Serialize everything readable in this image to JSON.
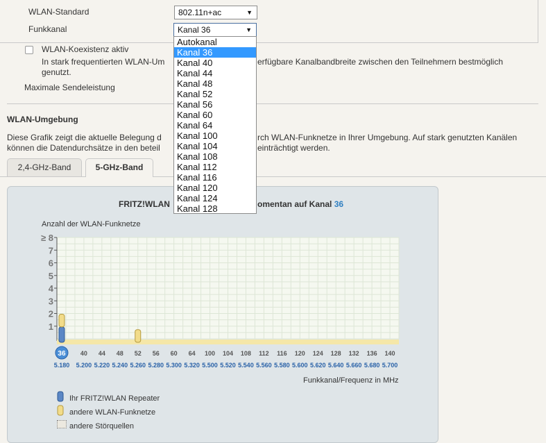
{
  "settings": {
    "wlan_standard_label": "WLAN-Standard",
    "wlan_standard_value": "802.11n+ac",
    "funkkanal_label": "Funkkanal",
    "funkkanal_value": "Kanal 36",
    "coexist_label": "WLAN-Koexistenz aktiv",
    "coexist_desc_part1": "In stark frequentierten WLAN-Um",
    "coexist_desc_part2": "erfügbare Kanalbandbreite zwischen den Teilnehmern bestmöglich",
    "coexist_desc_line2": "genutzt.",
    "sendeleistung_label": "Maximale Sendeleistung"
  },
  "dropdown": {
    "items": [
      "Autokanal",
      "Kanal 36",
      "Kanal 40",
      "Kanal 44",
      "Kanal 48",
      "Kanal 52",
      "Kanal 56",
      "Kanal 60",
      "Kanal 64",
      "Kanal 100",
      "Kanal 104",
      "Kanal 108",
      "Kanal 112",
      "Kanal 116",
      "Kanal 120",
      "Kanal 124",
      "Kanal 128"
    ],
    "selected_index": 1
  },
  "umgebung": {
    "heading": "WLAN-Umgebung",
    "desc_line1a": "Diese Grafik zeigt die aktuelle Belegung d",
    "desc_line1b": "rch WLAN-Funknetze in Ihrer Umgebung. Auf stark genutzten Kanälen",
    "desc_line2a": "können die Datendurchsätze in den beteil",
    "desc_line2b": "einträchtigt werden."
  },
  "tabs": [
    {
      "label": "2,4-GHz-Band",
      "active": false
    },
    {
      "label": "5-GHz-Band",
      "active": true
    }
  ],
  "chart_title": {
    "part1": "FRITZ!WLAN",
    "part2": "omentan auf Kanal",
    "channel": "36"
  },
  "chart_data": {
    "type": "bar",
    "ylabel": "Anzahl der WLAN-Funknetze",
    "xlabel": "Funkkanal/Frequenz in MHz",
    "y_ticks": [
      "1",
      "2",
      "3",
      "4",
      "5",
      "6",
      "7",
      "≥ 8"
    ],
    "ylim": [
      0,
      8
    ],
    "channels": [
      "36",
      "40",
      "44",
      "48",
      "52",
      "56",
      "60",
      "64",
      "100",
      "104",
      "108",
      "112",
      "116",
      "120",
      "124",
      "128",
      "132",
      "136",
      "140"
    ],
    "frequencies": [
      "5.180",
      "5.200",
      "5.220",
      "5.240",
      "5.260",
      "5.280",
      "5.300",
      "5.320",
      "5.500",
      "5.520",
      "5.540",
      "5.560",
      "5.580",
      "5.600",
      "5.620",
      "5.640",
      "5.660",
      "5.680",
      "5.700"
    ],
    "series": [
      {
        "name": "Ihr FRITZ!WLAN Repeater",
        "values": [
          1,
          0,
          0,
          0,
          0,
          0,
          0,
          0,
          0,
          0,
          0,
          0,
          0,
          0,
          0,
          0,
          0,
          0,
          0
        ]
      },
      {
        "name": "andere WLAN-Funknetze",
        "values": [
          1,
          0,
          0,
          0,
          1,
          0,
          0,
          0,
          0,
          0,
          0,
          0,
          0,
          0,
          0,
          0,
          0,
          0,
          0
        ]
      }
    ],
    "current_channel": "36",
    "colors": {
      "repeater": "#5b87c5",
      "other": "#f2dc8a",
      "band": "#f5e7a8",
      "grid_bg": "#f5f8f0"
    }
  },
  "legend": {
    "repeater": "Ihr FRITZ!WLAN Repeater",
    "other_networks": "andere WLAN-Funknetze",
    "interference": "andere Störquellen"
  }
}
